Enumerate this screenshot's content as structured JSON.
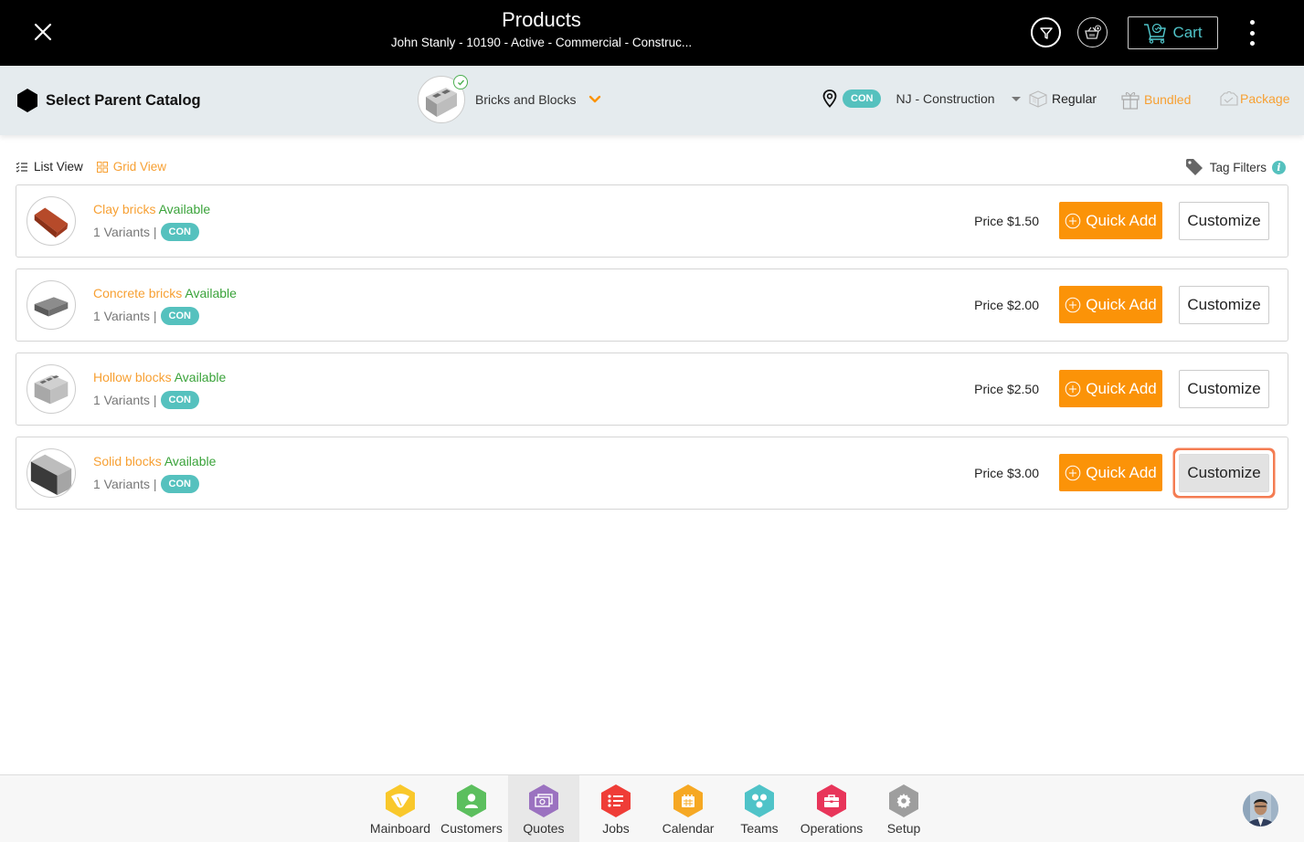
{
  "header": {
    "title": "Products",
    "subtitle": "John Stanly - 10190 - Active - Commercial - Construc...",
    "cart_label": "Cart",
    "icons": [
      "close-icon",
      "filter-icon",
      "basket-add-icon",
      "cart-icon",
      "more-vertical-icon"
    ]
  },
  "catalog_bar": {
    "parent_label": "Select Parent Catalog",
    "selected_catalog": "Bricks and Blocks",
    "location_badge": "CON",
    "location_name": "NJ - Construction",
    "product_types": [
      {
        "label": "Regular",
        "color": "#222222"
      },
      {
        "label": "Bundled",
        "color": "#f7a033"
      },
      {
        "label": "Package",
        "color": "#f7a033"
      }
    ]
  },
  "toolbar": {
    "list_view": "List View",
    "grid_view": "Grid View",
    "tag_filters": "Tag Filters",
    "info": "i"
  },
  "products": [
    {
      "name": "Clay bricks",
      "status": "Available",
      "variants": "1 Variants |",
      "badge": "CON",
      "price": "Price $1.50",
      "quick_add": "Quick Add",
      "customize": "Customize"
    },
    {
      "name": "Concrete bricks",
      "status": "Available",
      "variants": "1 Variants |",
      "badge": "CON",
      "price": "Price $2.00",
      "quick_add": "Quick Add",
      "customize": "Customize"
    },
    {
      "name": "Hollow blocks",
      "status": "Available",
      "variants": "1 Variants |",
      "badge": "CON",
      "price": "Price $2.50",
      "quick_add": "Quick Add",
      "customize": "Customize"
    },
    {
      "name": "Solid blocks",
      "status": "Available",
      "variants": "1 Variants |",
      "badge": "CON",
      "price": "Price $3.00",
      "quick_add": "Quick Add",
      "customize": "Customize"
    }
  ],
  "bottom_nav": [
    {
      "label": "Mainboard",
      "color": "#f9c82b"
    },
    {
      "label": "Customers",
      "color": "#5cbf5e"
    },
    {
      "label": "Quotes",
      "color": "#9b72c0",
      "active": true
    },
    {
      "label": "Jobs",
      "color": "#ef3d37"
    },
    {
      "label": "Calendar",
      "color": "#f6a823"
    },
    {
      "label": "Teams",
      "color": "#4fc3c8"
    },
    {
      "label": "Operations",
      "color": "#e8355a"
    },
    {
      "label": "Setup",
      "color": "#9e9e9e"
    }
  ],
  "colors": {
    "accent": "#fb9308",
    "teal": "#55c1be",
    "available": "#3aa33a",
    "focus_ring": "#f47c52"
  }
}
